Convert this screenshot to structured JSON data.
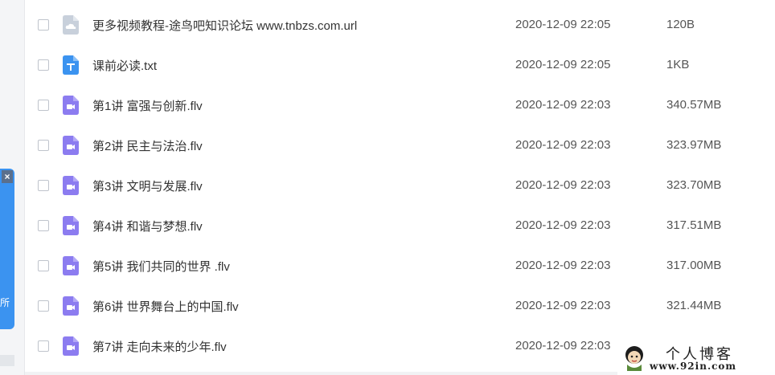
{
  "sidebar": {
    "close_label": "×",
    "partial_text": "所"
  },
  "rows": [
    {
      "icon": "cloud-file-icon",
      "name": "更多视频教程-途鸟吧知识论坛 www.tnbzs.com.url",
      "date": "2020-12-09 22:05",
      "size": "120B"
    },
    {
      "icon": "text-file-icon",
      "name": "课前必读.txt",
      "date": "2020-12-09 22:05",
      "size": "1KB"
    },
    {
      "icon": "video-file-icon",
      "name": "第1讲 富强与创新.flv",
      "date": "2020-12-09 22:03",
      "size": "340.57MB"
    },
    {
      "icon": "video-file-icon",
      "name": "第2讲 民主与法治.flv",
      "date": "2020-12-09 22:03",
      "size": "323.97MB"
    },
    {
      "icon": "video-file-icon",
      "name": "第3讲 文明与发展.flv",
      "date": "2020-12-09 22:03",
      "size": "323.70MB"
    },
    {
      "icon": "video-file-icon",
      "name": "第4讲 和谐与梦想.flv",
      "date": "2020-12-09 22:03",
      "size": "317.51MB"
    },
    {
      "icon": "video-file-icon",
      "name": "第5讲 我们共同的世界 .flv",
      "date": "2020-12-09 22:03",
      "size": "317.00MB"
    },
    {
      "icon": "video-file-icon",
      "name": "第6讲 世界舞台上的中国.flv",
      "date": "2020-12-09 22:03",
      "size": "321.44MB"
    },
    {
      "icon": "video-file-icon",
      "name": "第7讲 走向未来的少年.flv",
      "date": "2020-12-09 22:03",
      "size": ""
    }
  ],
  "watermark": {
    "title": "个人博客",
    "url": "www.92in.com"
  },
  "colors": {
    "video_icon": "#8c7cf0",
    "text_icon": "#3b93f0",
    "cloud_icon": "#c8d0db",
    "sidebar_panel": "#3b93f0"
  }
}
